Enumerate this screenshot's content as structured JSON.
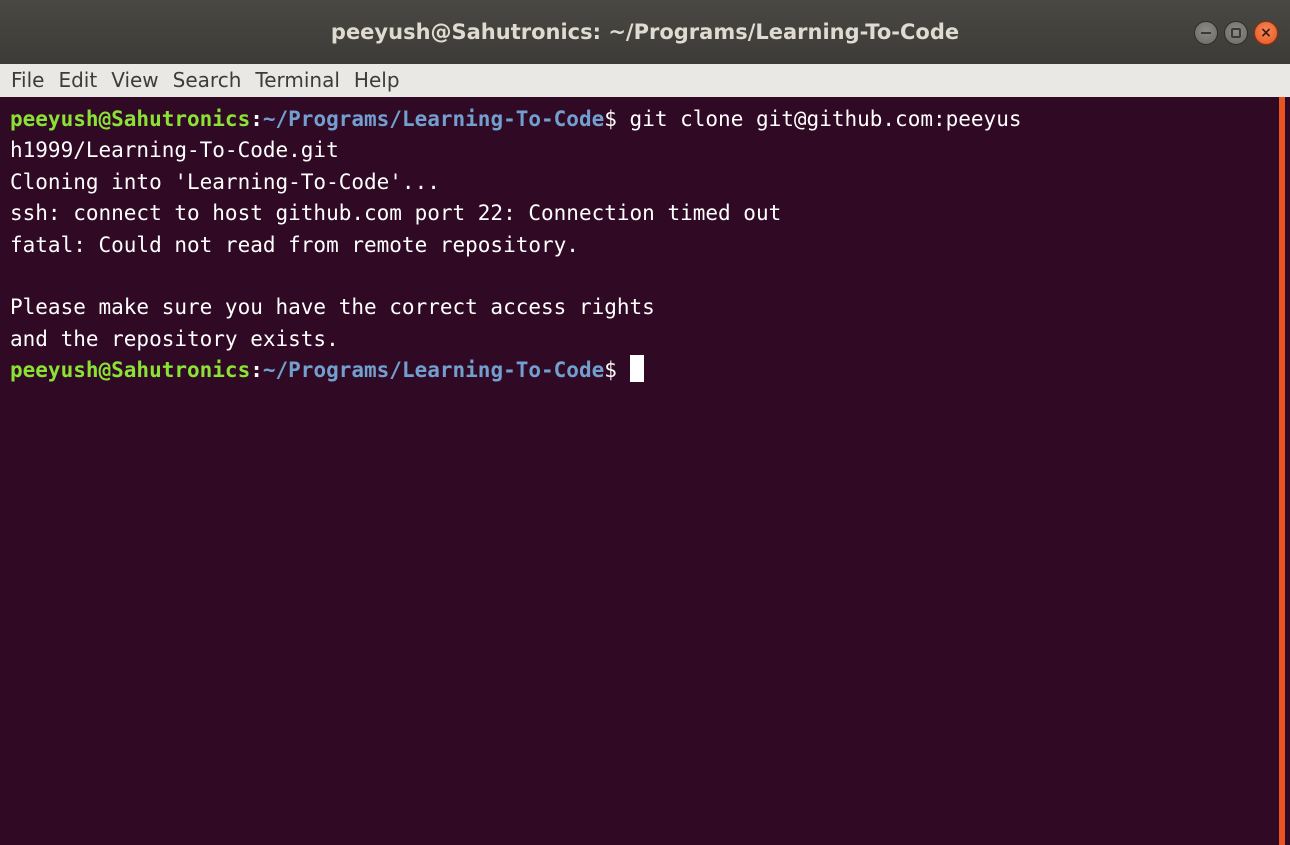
{
  "window": {
    "title": "peeyush@Sahutronics: ~/Programs/Learning-To-Code",
    "close_glyph": "×"
  },
  "menubar": {
    "items": [
      {
        "label": "File"
      },
      {
        "label": "Edit"
      },
      {
        "label": "View"
      },
      {
        "label": "Search"
      },
      {
        "label": "Terminal"
      },
      {
        "label": "Help"
      }
    ]
  },
  "terminal": {
    "prompt": {
      "user_host": "peeyush@Sahutronics",
      "colon": ":",
      "path": "~/Programs/Learning-To-Code",
      "dollar": "$ "
    },
    "command": "git clone git@github.com:peeyus",
    "command_wrap": "h1999/Learning-To-Code.git",
    "output": [
      "Cloning into 'Learning-To-Code'...",
      "ssh: connect to host github.com port 22: Connection timed out",
      "fatal: Could not read from remote repository.",
      "",
      "Please make sure you have the correct access rights",
      "and the repository exists."
    ]
  },
  "colors": {
    "terminal_bg": "#300a24",
    "prompt_user": "#8ae234",
    "prompt_path": "#729fcf",
    "accent": "#e95420"
  }
}
